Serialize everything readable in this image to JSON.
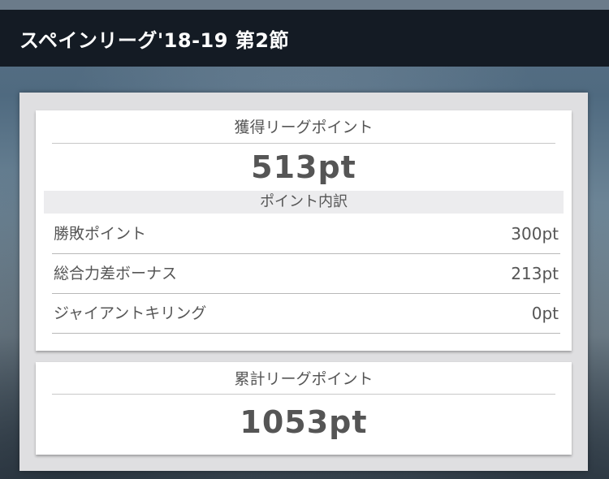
{
  "header": {
    "title": "スペインリーグ'18-19 第2節"
  },
  "earned": {
    "heading": "獲得リーグポイント",
    "value": "513pt",
    "breakdown_heading": "ポイント内訳",
    "rows": [
      {
        "label": "勝敗ポイント",
        "value": "300pt"
      },
      {
        "label": "総合力差ボーナス",
        "value": "213pt"
      },
      {
        "label": "ジャイアントキリング",
        "value": "0pt"
      }
    ]
  },
  "total": {
    "heading": "累計リーグポイント",
    "value": "1053pt"
  },
  "colors": {
    "header_bg": "#141b24",
    "panel_bg": "#dfdfe1",
    "card_bg": "#ffffff",
    "text": "#555555",
    "band_bg": "#ececee"
  }
}
